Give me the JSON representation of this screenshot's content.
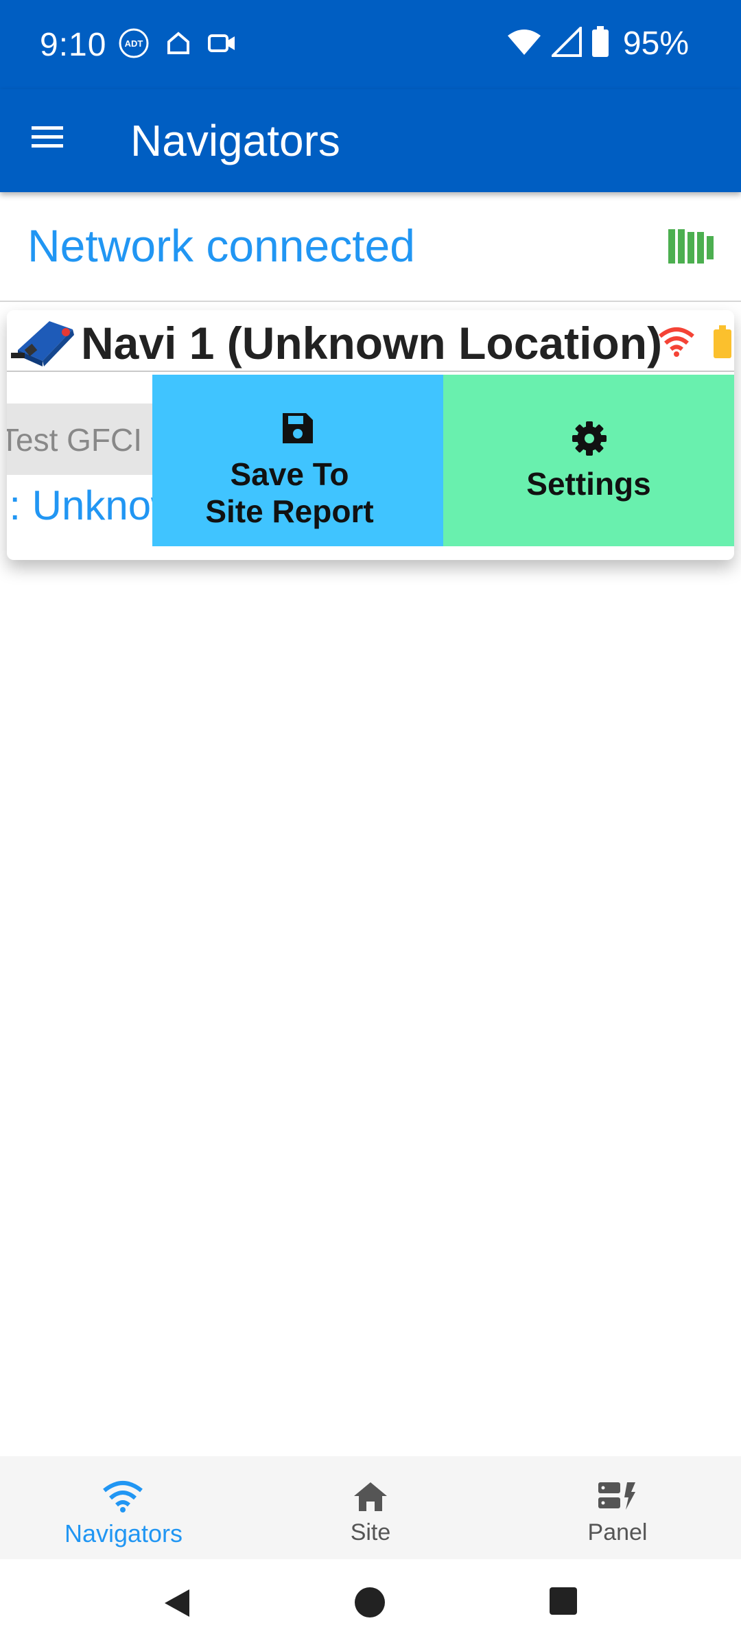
{
  "status_bar": {
    "time": "9:10",
    "battery_percent": "95%",
    "left_icons": [
      "adt-icon",
      "home-icon",
      "camera-icon"
    ],
    "right_icons": [
      "wifi-icon",
      "signal-icon",
      "battery-icon"
    ]
  },
  "app_bar": {
    "title": "Navigators",
    "menu_icon": "hamburger-menu-icon"
  },
  "network": {
    "status_text": "Network connected",
    "icon": "network-bars-icon",
    "icon_color": "#4caf50"
  },
  "device_card": {
    "name": "Navi 1 (Unknown Location)",
    "wifi_color": "#f44336",
    "battery_color": "#fbc02d",
    "test_gfci_label": "Test GFCI",
    "status_text": "l: Unknown",
    "save_label_line1": "Save To",
    "save_label_line2": "Site Report",
    "save_color": "#40c4ff",
    "settings_label": "Settings",
    "settings_color": "#69f0ae"
  },
  "bottom_nav": {
    "active_color": "#2196f3",
    "items": [
      {
        "label": "Navigators",
        "icon": "wifi-icon"
      },
      {
        "label": "Site",
        "icon": "home-icon"
      },
      {
        "label": "Panel",
        "icon": "panel-icon"
      }
    ]
  },
  "colors": {
    "primary": "#005ec2",
    "accent": "#2196f3"
  }
}
